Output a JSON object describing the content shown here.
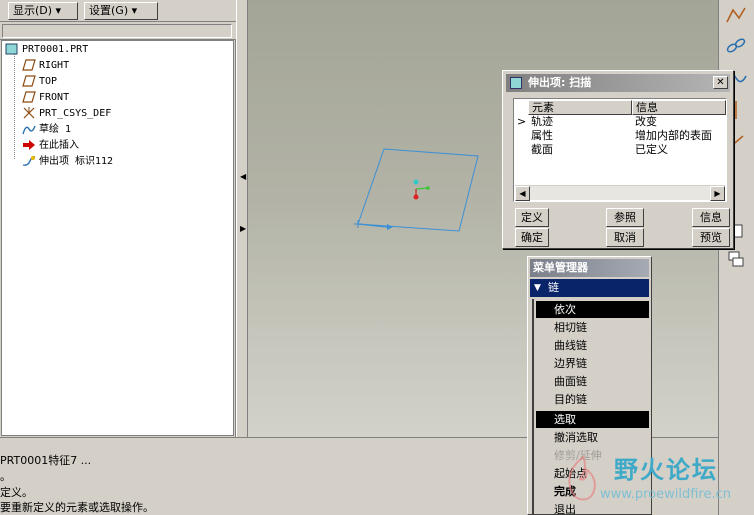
{
  "menubar": {
    "display_label": "显示(D) ▾",
    "settings_label": "设置(G) ▾"
  },
  "tree": {
    "root": "PRT0001.PRT",
    "items": [
      {
        "label": "RIGHT",
        "icon": "datum-plane-icon"
      },
      {
        "label": "TOP",
        "icon": "datum-plane-icon"
      },
      {
        "label": "FRONT",
        "icon": "datum-plane-icon"
      },
      {
        "label": "PRT_CSYS_DEF",
        "icon": "csys-icon"
      },
      {
        "label": "草绘 1",
        "icon": "sketch-icon"
      },
      {
        "label": "在此插入",
        "icon": "insert-here-arrow-icon"
      },
      {
        "label": "伸出项 标识112",
        "icon": "sweep-feature-icon"
      }
    ]
  },
  "dialog": {
    "title": "伸出项: 扫描",
    "columns": [
      "元素",
      "信息"
    ],
    "rows": [
      {
        "marker": ">",
        "element": "轨迹",
        "info": "改变"
      },
      {
        "marker": "",
        "element": "属性",
        "info": "增加内部的表面"
      },
      {
        "marker": "",
        "element": "截面",
        "info": "已定义"
      }
    ],
    "buttons": {
      "define": "定义",
      "reference": "参照",
      "info": "信息",
      "ok": "确定",
      "cancel": "取消",
      "preview": "预览"
    }
  },
  "menu_manager": {
    "title": "菜单管理器",
    "chain_label": "链",
    "items": [
      {
        "label": "依次",
        "state": "selected"
      },
      {
        "label": "相切链",
        "state": "normal"
      },
      {
        "label": "曲线链",
        "state": "normal"
      },
      {
        "label": "边界链",
        "state": "normal"
      },
      {
        "label": "曲面链",
        "state": "normal"
      },
      {
        "label": "目的链",
        "state": "normal"
      },
      {
        "label": "选取",
        "state": "selected"
      },
      {
        "label": "撤消选取",
        "state": "normal"
      },
      {
        "label": "修剪/延伸",
        "state": "disabled"
      },
      {
        "label": "起始点",
        "state": "normal"
      },
      {
        "label": "完成",
        "state": "normal"
      },
      {
        "label": "退出",
        "state": "normal"
      }
    ]
  },
  "messages": [
    "PRT0001特征7 ...",
    "。",
    "定义。",
    "要重新定义的元素或选取操作。"
  ],
  "watermark": {
    "text": "野火论坛",
    "url": "www.proewildfire.cn"
  },
  "colors": {
    "title_active": "#0a246a",
    "sketch_line": "#3b8fd6",
    "insert_arrow": "#d00000"
  }
}
